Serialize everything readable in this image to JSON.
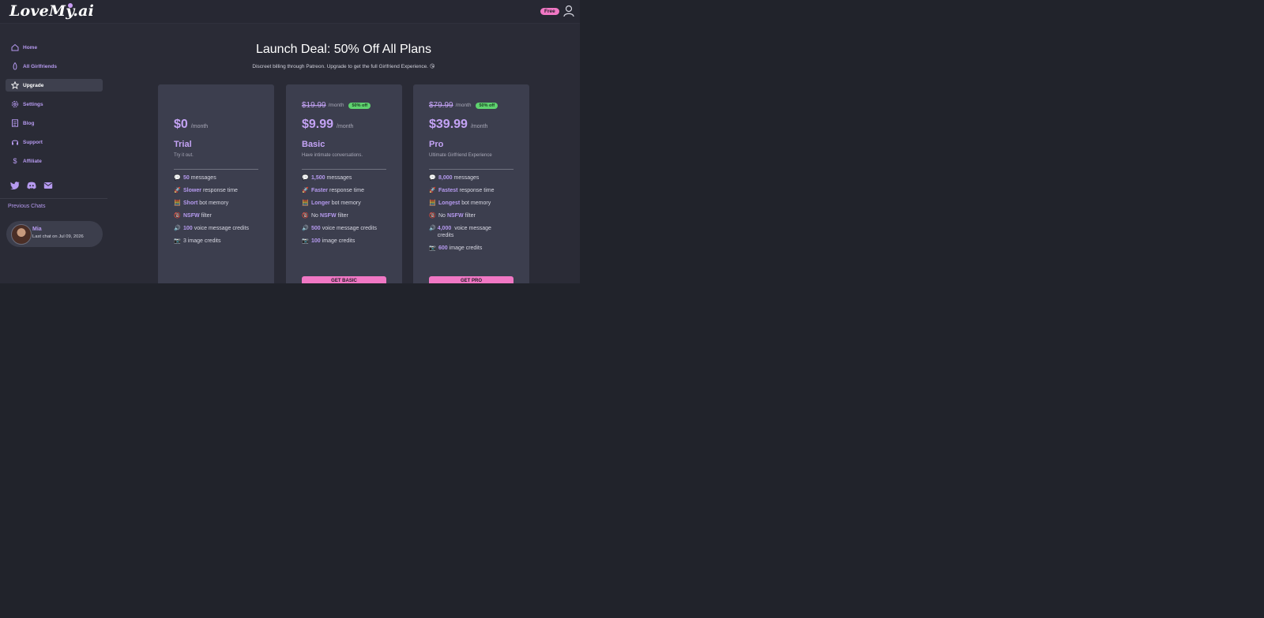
{
  "header": {
    "logo": "LoveMy.ai",
    "plan_badge": "Free"
  },
  "sidebar": {
    "items": [
      {
        "label": "Home",
        "icon": "home-icon"
      },
      {
        "label": "All Girlfriends",
        "icon": "flame-icon"
      },
      {
        "label": "Upgrade",
        "icon": "star-icon",
        "active": true
      },
      {
        "label": "Settings",
        "icon": "gear-icon"
      },
      {
        "label": "Blog",
        "icon": "document-icon"
      },
      {
        "label": "Support",
        "icon": "headset-icon"
      },
      {
        "label": "Affiliate",
        "icon": "dollar-icon"
      }
    ],
    "socials": [
      "twitter-icon",
      "discord-icon",
      "mail-icon"
    ],
    "previous_chats_title": "Previous Chats",
    "chats": [
      {
        "name": "Mia",
        "subtitle": "Last chat on Jul 09, 2026"
      }
    ]
  },
  "main": {
    "title": "Launch Deal: 50% Off All Plans",
    "subtitle": "Discreet billing through Patreon. Upgrade to get the full Girlfriend Experience. 😘",
    "plans": [
      {
        "price": "$0",
        "per": "/month",
        "name": "Trial",
        "tagline": "Try it out.",
        "features": [
          {
            "emoji": "💬",
            "highlight": "50",
            "text": "messages"
          },
          {
            "emoji": "🚀",
            "highlight": "Slower",
            "text": "response time"
          },
          {
            "emoji": "🧮",
            "highlight": "Short",
            "text": "bot memory"
          },
          {
            "emoji": "🔞",
            "highlight": "NSFW",
            "text": "filter"
          },
          {
            "emoji": "🔊",
            "highlight": "100",
            "text": "voice message credits"
          },
          {
            "emoji": "📷",
            "highlight": "",
            "text": "3 image credits"
          }
        ]
      },
      {
        "old_price": "$19.99",
        "old_per": "/month",
        "discount": "50% off",
        "price": "$9.99",
        "per": "/month",
        "name": "Basic",
        "tagline": "Have intimate conversations.",
        "features": [
          {
            "emoji": "💬",
            "highlight": "1,500",
            "text": "messages"
          },
          {
            "emoji": "🚀",
            "highlight": "Faster",
            "text": "response time"
          },
          {
            "emoji": "🧮",
            "highlight": "Longer",
            "text": "bot memory"
          },
          {
            "emoji": "🔞",
            "prefix": "No",
            "highlight": "NSFW",
            "text": "filter"
          },
          {
            "emoji": "🔊",
            "highlight": "500",
            "text": "voice message credits"
          },
          {
            "emoji": "📷",
            "highlight": "100",
            "text": "image credits"
          }
        ],
        "cta": "GET BASIC"
      },
      {
        "old_price": "$79.99",
        "old_per": "/month",
        "discount": "50% off",
        "price": "$39.99",
        "per": "/month",
        "name": "Pro",
        "tagline": "Ultimate Girlfriend Experience",
        "features": [
          {
            "emoji": "💬",
            "highlight": "8,000",
            "text": "messages"
          },
          {
            "emoji": "🚀",
            "highlight": "Fastest",
            "text": "response time"
          },
          {
            "emoji": "🧮",
            "highlight": "Longest",
            "text": "bot memory"
          },
          {
            "emoji": "🔞",
            "prefix": "No",
            "highlight": "NSFW",
            "text": "filter"
          },
          {
            "emoji": "🔊",
            "highlight": "4,000",
            "text": "voice message credits"
          },
          {
            "emoji": "📷",
            "highlight": "600",
            "text": "image credits"
          }
        ],
        "cta": "GET PRO"
      }
    ]
  }
}
